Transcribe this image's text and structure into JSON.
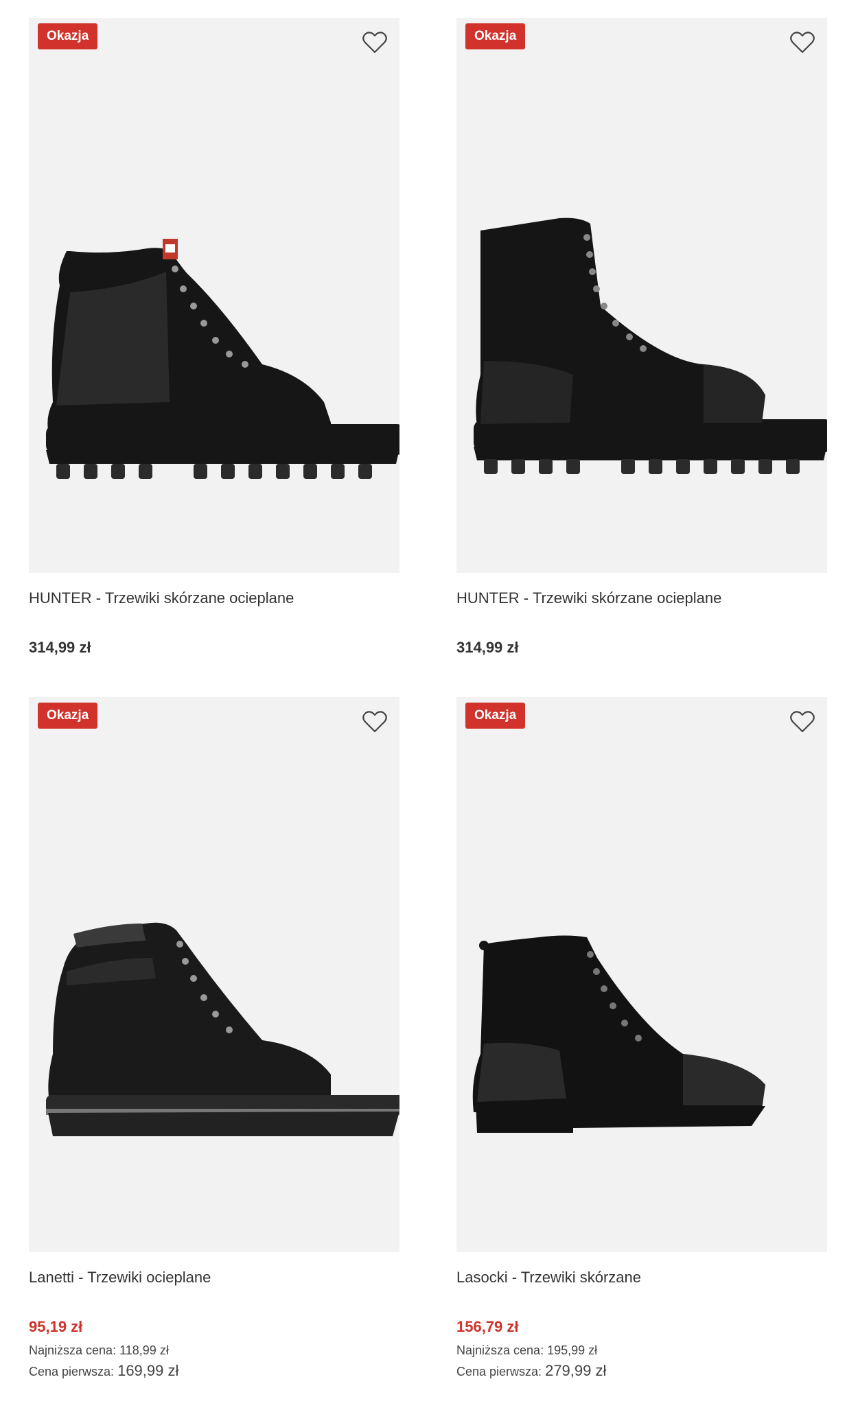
{
  "colors": {
    "accent": "#d1322b",
    "card_bg": "#f2f2f2",
    "text": "#333333"
  },
  "products": [
    {
      "badge": "Okazja",
      "title": "HUNTER - Trzewiki skórzane ocieplane",
      "price": "314,99 zł",
      "wishlist_icon": "heart-outline-icon"
    },
    {
      "badge": "Okazja",
      "title": "HUNTER - Trzewiki skórzane ocieplane",
      "price": "314,99 zł",
      "wishlist_icon": "heart-outline-icon"
    },
    {
      "badge": "Okazja",
      "title": "Lanetti - Trzewiki ocieplane",
      "price": "95,19 zł",
      "lowest_label": "Najniższa cena:",
      "lowest_value": "118,99 zł",
      "first_label": "Cena pierwsza:",
      "first_value": "169,99 zł",
      "wishlist_icon": "heart-outline-icon"
    },
    {
      "badge": "Okazja",
      "title": "Lasocki - Trzewiki skórzane",
      "price": "156,79 zł",
      "lowest_label": "Najniższa cena:",
      "lowest_value": "195,99 zł",
      "first_label": "Cena pierwsza:",
      "first_value": "279,99 zł",
      "wishlist_icon": "heart-outline-icon"
    }
  ]
}
